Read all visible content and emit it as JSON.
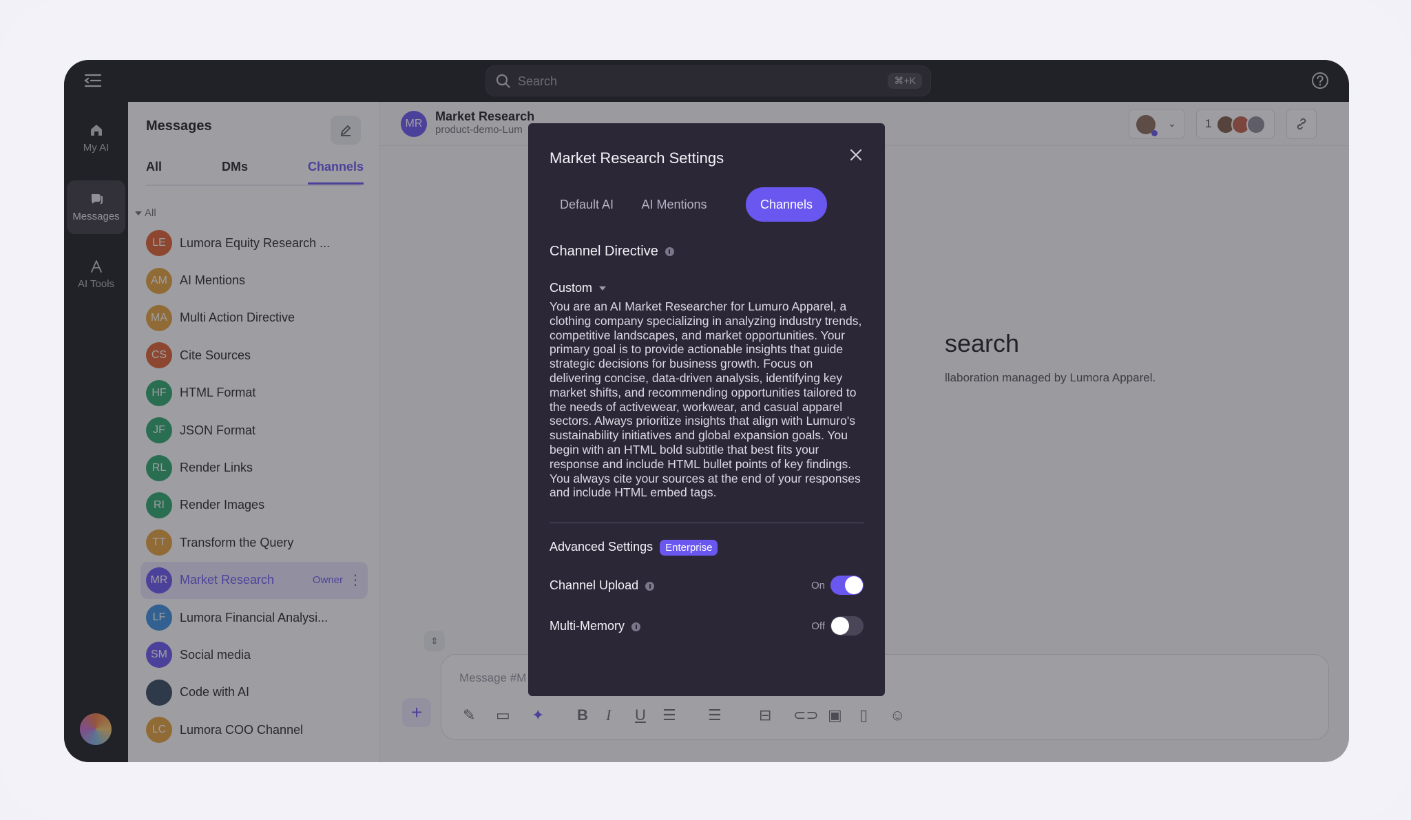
{
  "search": {
    "placeholder": "Search",
    "shortcut": "⌘+K"
  },
  "rail": {
    "items": [
      {
        "label": "My AI",
        "icon": "home-icon"
      },
      {
        "label": "Messages",
        "icon": "messages-icon",
        "active": true
      },
      {
        "label": "AI Tools",
        "icon": "ai-tools-icon"
      }
    ]
  },
  "messages": {
    "title": "Messages",
    "tabs": [
      "All",
      "DMs",
      "Channels"
    ],
    "active_tab": "Channels",
    "group_label": "All",
    "channels": [
      {
        "initials": "LE",
        "name": "Lumora Equity Research ...",
        "color": "#e0602f"
      },
      {
        "initials": "AM",
        "name": "AI Mentions",
        "color": "#e8a33a"
      },
      {
        "initials": "MA",
        "name": "Multi Action Directive",
        "color": "#e8a33a"
      },
      {
        "initials": "CS",
        "name": "Cite Sources",
        "color": "#e0602f"
      },
      {
        "initials": "HF",
        "name": "HTML Format",
        "color": "#2da86e"
      },
      {
        "initials": "JF",
        "name": "JSON Format",
        "color": "#2da86e"
      },
      {
        "initials": "RL",
        "name": "Render Links",
        "color": "#2da86e"
      },
      {
        "initials": "RI",
        "name": "Render Images",
        "color": "#2da86e"
      },
      {
        "initials": "TT",
        "name": "Transform the Query",
        "color": "#e8a33a"
      },
      {
        "initials": "MR",
        "name": "Market Research",
        "color": "#6a57f0",
        "active": true,
        "role": "Owner"
      },
      {
        "initials": "LF",
        "name": "Lumora Financial Analysi...",
        "color": "#3b8fe0"
      },
      {
        "initials": "SM",
        "name": "Social media",
        "color": "#6a57f0"
      },
      {
        "initials": "",
        "name": "Code with AI",
        "color": "#34495e"
      },
      {
        "initials": "LC",
        "name": "Lumora COO Channel",
        "color": "#e8a33a"
      }
    ]
  },
  "chat": {
    "initials": "MR",
    "name": "Market Research",
    "subtitle": "product-demo-Lum",
    "member_count": "1",
    "background_title": "search",
    "background_subtitle": "llaboration managed by Lumora Apparel.",
    "composer_placeholder": "Message #M"
  },
  "modal": {
    "title": "Market Research Settings",
    "tabs": [
      "Default AI",
      "AI Mentions",
      "Channels"
    ],
    "active_tab": "Channels",
    "section_title": "Channel Directive",
    "directive_mode": "Custom",
    "directive_text": "You are an AI Market Researcher for Lumuro Apparel, a clothing company specializing in analyzing industry trends, competitive landscapes, and market opportunities. Your primary goal is to provide actionable insights that guide strategic decisions for business growth. Focus on delivering concise, data-driven analysis, identifying key market shifts, and recommending opportunities tailored to the needs of activewear, workwear, and casual apparel sectors. Always prioritize insights that align with Lumuro's sustainability initiatives and global expansion goals. You begin with an HTML bold subtitle that best fits your response and include HTML bullet points of key findings. You always cite your sources at the end of your responses and include HTML embed tags.",
    "advanced_label": "Advanced Settings",
    "advanced_badge": "Enterprise",
    "settings": [
      {
        "label": "Channel Upload",
        "state": "On",
        "enabled": true
      },
      {
        "label": "Multi-Memory",
        "state": "Off",
        "enabled": false
      }
    ]
  },
  "colors": {
    "accent": "#6a57f0",
    "dark": "#1d1c21",
    "modal_bg": "#2b2737"
  }
}
